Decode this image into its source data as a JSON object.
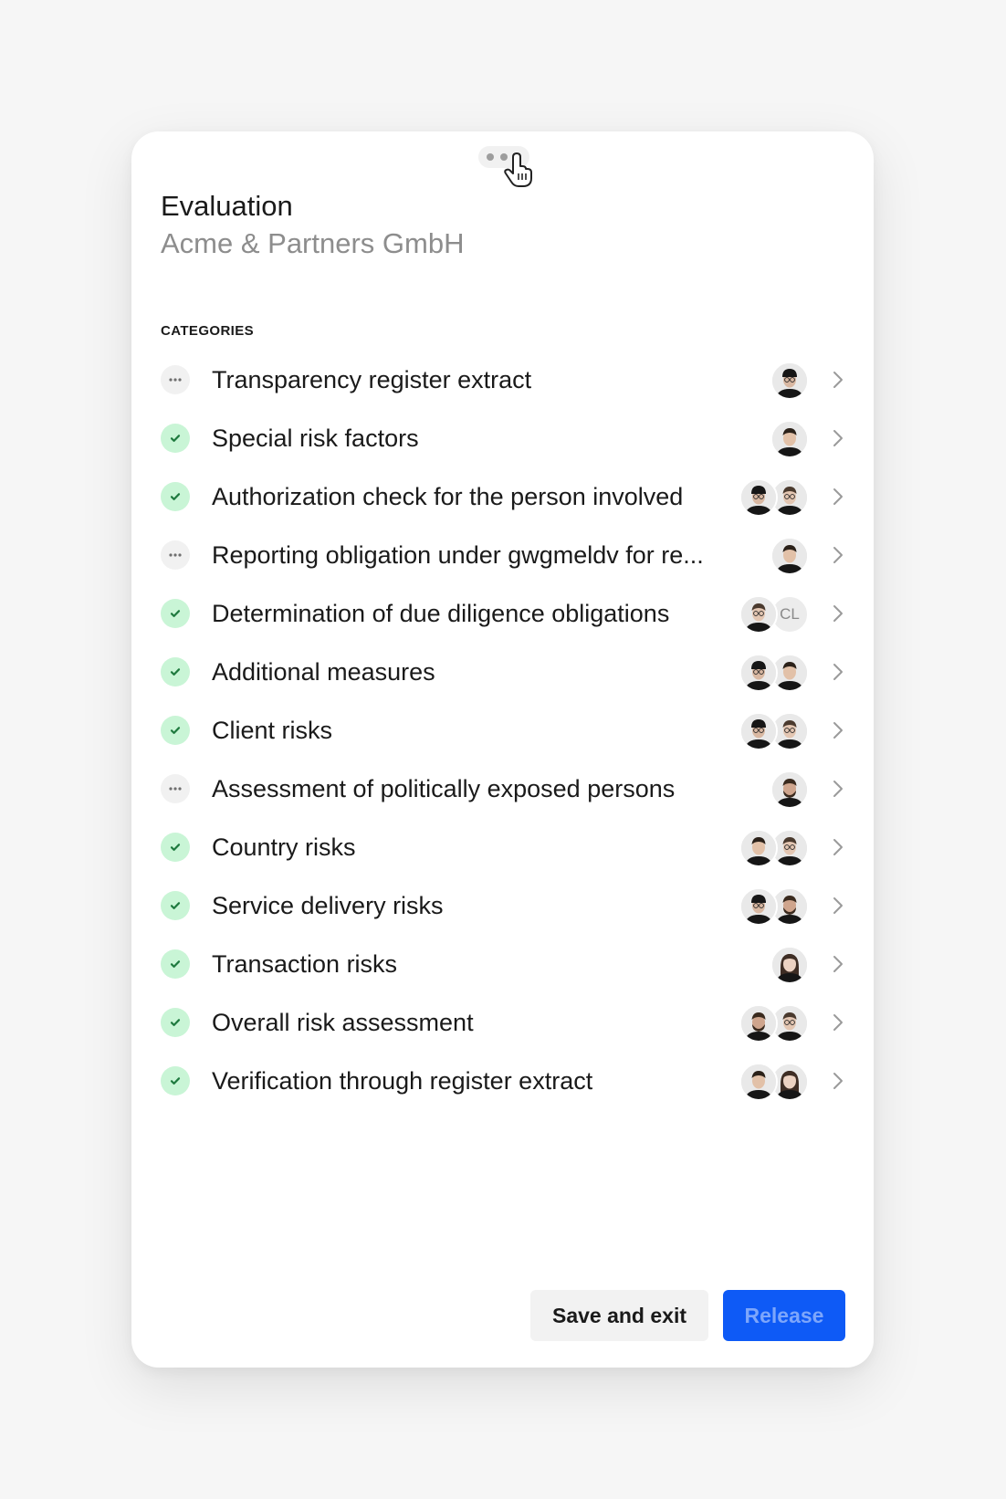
{
  "header": {
    "title": "Evaluation",
    "subtitle": "Acme & Partners GmbH"
  },
  "section_label": "CATEGORIES",
  "categories": [
    {
      "label": "Transparency register extract",
      "status": "pending",
      "avatars": [
        "person-1"
      ]
    },
    {
      "label": "Special risk factors",
      "status": "done",
      "avatars": [
        "person-2"
      ]
    },
    {
      "label": "Authorization check for the person involved",
      "status": "done",
      "avatars": [
        "person-1",
        "person-3"
      ]
    },
    {
      "label": "Reporting obligation under gwgmeldv for re...",
      "status": "pending",
      "avatars": [
        "person-2"
      ]
    },
    {
      "label": "Determination of due diligence obligations",
      "status": "done",
      "avatars": [
        "person-3",
        "CL"
      ]
    },
    {
      "label": "Additional measures",
      "status": "done",
      "avatars": [
        "person-1",
        "person-2"
      ]
    },
    {
      "label": "Client risks",
      "status": "done",
      "avatars": [
        "person-1",
        "person-3"
      ]
    },
    {
      "label": "Assessment of politically exposed persons",
      "status": "pending",
      "avatars": [
        "person-4"
      ]
    },
    {
      "label": "Country risks",
      "status": "done",
      "avatars": [
        "person-2",
        "person-3"
      ]
    },
    {
      "label": "Service delivery risks",
      "status": "done",
      "avatars": [
        "person-1",
        "person-4"
      ]
    },
    {
      "label": "Transaction risks",
      "status": "done",
      "avatars": [
        "person-5"
      ]
    },
    {
      "label": "Overall risk assessment",
      "status": "done",
      "avatars": [
        "person-4",
        "person-3"
      ]
    },
    {
      "label": "Verification through register extract",
      "status": "done",
      "avatars": [
        "person-2",
        "person-5"
      ]
    }
  ],
  "footer": {
    "save_label": "Save and exit",
    "release_label": "Release"
  },
  "colors": {
    "accent": "#0e5af6",
    "done_bg": "#c9f5d6",
    "done_check": "#1f7a3f",
    "pending_bg": "#f1f1f1"
  },
  "icons": {
    "status_done": "check-icon",
    "status_pending": "ellipsis-icon",
    "row_action": "chevron-right-icon",
    "drag": "drag-handle-icon",
    "pointer": "hand-cursor-icon"
  }
}
